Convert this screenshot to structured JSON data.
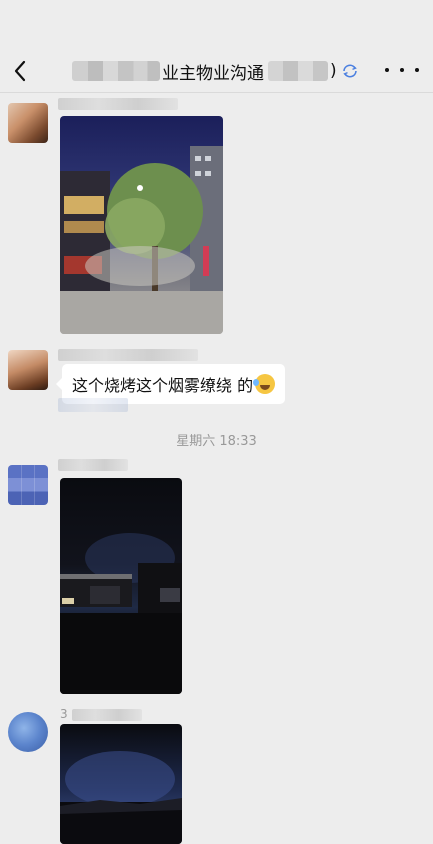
{
  "header": {
    "title": "业主物业沟通",
    "paren_close": ")"
  },
  "time_separator": "星期六 18:33",
  "messages": [
    {
      "type": "image"
    },
    {
      "type": "text",
      "text": "这个烧烤这个烟雾缭绕 的"
    },
    {
      "type": "image"
    },
    {
      "sender_prefix": "3",
      "type": "image"
    }
  ],
  "colors": {
    "background": "#ededed",
    "bubble": "#ffffff",
    "accent": "#4a7fe0"
  },
  "icons": [
    "back-arrow-icon",
    "sync-icon",
    "more-icon",
    "emoji-icon"
  ]
}
